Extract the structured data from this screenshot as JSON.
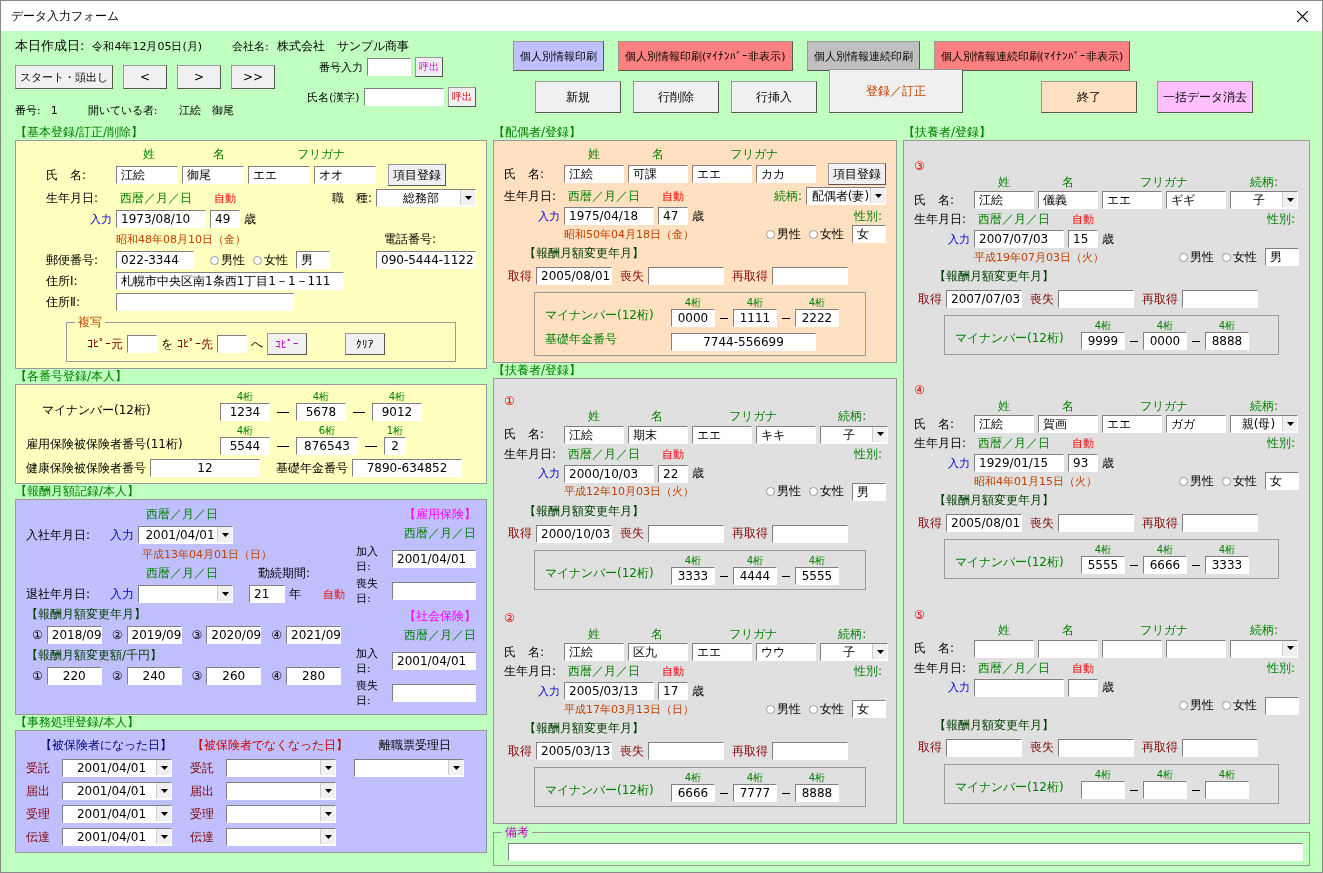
{
  "window": {
    "title": "データ入力フォーム"
  },
  "header": {
    "date_label": "本日作成日:",
    "date": "令和4年12月05日(月)",
    "company_label": "会社名:",
    "company": "株式会社　サンプル商事",
    "number_label": "番号:",
    "number": "1",
    "open_label": "開いている者:",
    "open_name": "江絵　御尾"
  },
  "nav_buttons": [
    "スタート・頭出し",
    "<",
    ">",
    ">>"
  ],
  "lookups": [
    {
      "label": "番号入力",
      "button": "呼出"
    },
    {
      "label": "氏名(漢字)",
      "button": "呼出"
    }
  ],
  "print_buttons": [
    {
      "label": "個人別情報印刷",
      "color": "#c0c0ff"
    },
    {
      "label": "個人別情報印刷(ﾏｲﾅﾝﾊﾞｰ非表示)",
      "color": "#ff8080"
    },
    {
      "label": "個人別情報連続印刷",
      "color": "#c0c0c0"
    },
    {
      "label": "個人別情報連続印刷(ﾏｲﾅﾝﾊﾞｰ非表示)",
      "color": "#ff8080"
    }
  ],
  "action_buttons": [
    {
      "label": "新規",
      "kind": "normal",
      "color": "#f0f0f0"
    },
    {
      "label": "行削除",
      "kind": "normal",
      "color": "#f0f0f0"
    },
    {
      "label": "行挿入",
      "kind": "normal",
      "color": "#f0f0f0"
    },
    {
      "label": "登録／訂正",
      "kind": "large",
      "color": "#f0f0f0"
    },
    {
      "label": "終了",
      "kind": "normal",
      "color": "#ffe0c0"
    },
    {
      "label": "一括データ消去",
      "kind": "normal",
      "color": "#ffc0ff"
    }
  ],
  "basic": {
    "title": "【基本登録/訂正/削除】",
    "name_label": "氏　名:",
    "headers": [
      "姓",
      "名",
      "フリガナ"
    ],
    "names": [
      "江絵",
      "御尾",
      "エエ",
      "オオ"
    ],
    "register_button": "項目登録",
    "birth_label": "生年月日:",
    "date_format": "西暦／月／日",
    "auto_label": "自動",
    "job_label": "職　種:",
    "job": "総務部",
    "input_label": "入力",
    "birth": "1973/08/10",
    "age": "49",
    "age_unit": "歳",
    "wareki": "昭和48年08月10日（金）",
    "phone_label": "電話番号:",
    "zip_label": "郵便番号:",
    "zip": "022-3344",
    "genders": [
      {
        "label": "男性",
        "selected": false
      },
      {
        "label": "女性",
        "selected": false
      }
    ],
    "gender": "男",
    "phone": "090-5444-1122",
    "addresses": [
      {
        "label": "住所Ⅰ:",
        "value": "札幌市中央区南1条西1丁目1－1－111"
      },
      {
        "label": "住所Ⅱ:"
      }
    ],
    "copy": {
      "title": "複写",
      "from_label": "ｺﾋﾟｰ元",
      "between": "を",
      "to_label": "ｺﾋﾟｰ先",
      "after": "へ",
      "copy_button": "ｺﾋﾟｰ",
      "clear_button": "ｸﾘｱ"
    }
  },
  "numbers": {
    "title": "【各番号登録/本人】",
    "mynumber": {
      "label": "マイナンバー(12桁)",
      "digits": [
        "4桁",
        "4桁",
        "4桁"
      ],
      "parts": [
        "1234",
        "5678",
        "9012"
      ]
    },
    "employment": {
      "label": "雇用保険被保険者番号(11桁)",
      "digits": [
        "4桁",
        "6桁",
        "1桁"
      ],
      "parts": [
        "5544",
        "876543",
        "2"
      ]
    },
    "health_label": "健康保険被保険者番号",
    "health": "12",
    "pension_label": "基礎年金番号",
    "pension": "7890-634852"
  },
  "salary": {
    "title": "【報酬月額記録/本人】",
    "join_format": "西暦／月／日",
    "join_label": "入社年月日:",
    "join_input": "入力",
    "join": "2001/04/01",
    "join_wareki": "平成13年04月01日（日）",
    "leave_format": "西暦／月／日",
    "tenure_label": "勤続期間:",
    "leave_label": "退社年月日:",
    "leave_input": "入力",
    "tenure": "21",
    "tenure_unit": "年",
    "auto_label": "自動",
    "month_title": "【報酬月額変更年月】",
    "months": [
      {
        "no": "①",
        "value": "2018/09"
      },
      {
        "no": "②",
        "value": "2019/09"
      },
      {
        "no": "③",
        "value": "2020/09"
      },
      {
        "no": "④",
        "value": "2021/09"
      }
    ],
    "amount_title": "【報酬月額変更額/千円】",
    "amounts": [
      {
        "no": "①",
        "value": "220"
      },
      {
        "no": "②",
        "value": "240"
      },
      {
        "no": "③",
        "value": "260"
      },
      {
        "no": "④",
        "value": "280"
      }
    ],
    "insurance": [
      {
        "title": "【雇用保険】",
        "date_format": "西暦／月／日",
        "join_label": "加入日:",
        "join": "2001/04/01",
        "loss_label": "喪失日:"
      },
      {
        "title": "【社会保険】",
        "date_format": "西暦／月／日",
        "join_label": "加入日:",
        "join": "2001/04/01",
        "loss_label": "喪失日:"
      }
    ]
  },
  "office": {
    "title": "【事務処理登録/本人】",
    "columns": [
      {
        "title": "【被保険者になった日】",
        "color": "#000080",
        "rows": [
          {
            "label": "受託",
            "value": "2001/04/01"
          },
          {
            "label": "届出",
            "value": "2001/04/01"
          },
          {
            "label": "受理",
            "value": "2001/04/01"
          },
          {
            "label": "伝達",
            "value": "2001/04/01"
          }
        ]
      },
      {
        "title": "【被保険者でなくなった日】",
        "color": "#d00000",
        "rows": [
          {
            "label": "受託"
          },
          {
            "label": "届出"
          },
          {
            "label": "受理"
          },
          {
            "label": "伝達"
          }
        ]
      }
    ],
    "separation_title": "離職票受理日"
  },
  "spouse": {
    "title": "【配偶者/登録】",
    "name_label": "氏　名:",
    "headers": [
      "姓",
      "名",
      "フリガナ"
    ],
    "names": [
      "江絵",
      "可課",
      "エエ",
      "カカ"
    ],
    "register_button": "項目登録",
    "birth_label": "生年月日:",
    "date_format": "西暦／月／日",
    "auto_label": "自動",
    "relation_label": "続柄:",
    "relation": "配偶者(妻)",
    "input_label": "入力",
    "birth": "1975/04/18",
    "age": "47",
    "age_unit": "歳",
    "gender_label": "性別:",
    "wareki": "昭和50年04月18日（金）",
    "genders": [
      {
        "label": "男性",
        "selected": false
      },
      {
        "label": "女性",
        "selected": false
      }
    ],
    "gender": "女",
    "history_title": "【報酬月額変更年月】",
    "history": [
      {
        "label": "取得",
        "value": "2005/08/01"
      },
      {
        "label": "喪失"
      },
      {
        "label": "再取得"
      }
    ],
    "mynumber": {
      "label": "マイナンバー(12桁)",
      "digits": [
        "4桁",
        "4桁",
        "4桁"
      ],
      "parts": [
        "0000",
        "1111",
        "2222"
      ],
      "pension_label": "基礎年金番号",
      "pension": "7744-556699"
    }
  },
  "dependent_panels": [
    {
      "title": "【扶養者/登録】",
      "members": [
        {
          "no": "①",
          "name_label": "氏　名:",
          "headers": [
            "姓",
            "名",
            "フリガナ"
          ],
          "relation_label": "続柄:",
          "names": [
            "江絵",
            "期末",
            "エエ",
            "キキ"
          ],
          "relation": "子",
          "birth_label": "生年月日:",
          "date_format": "西暦／月／日",
          "auto_label": "自動",
          "gender_label": "性別:",
          "input_label": "入力",
          "birth": "2000/10/03",
          "age": "22",
          "age_unit": "歳",
          "genders": [
            {
              "label": "男性",
              "selected": false
            },
            {
              "label": "女性",
              "selected": false
            }
          ],
          "gender": "男",
          "wareki": "平成12年10月03日（火）",
          "history_title": "【報酬月額変更年月】",
          "history": [
            {
              "label": "取得",
              "value": "2000/10/03"
            },
            {
              "label": "喪失"
            },
            {
              "label": "再取得"
            }
          ],
          "mynumber": {
            "label": "マイナンバー(12桁)",
            "digits": [
              "4桁",
              "4桁",
              "4桁"
            ],
            "parts": [
              "3333",
              "4444",
              "5555"
            ]
          }
        },
        {
          "no": "②",
          "name_label": "氏　名:",
          "headers": [
            "姓",
            "名",
            "フリガナ"
          ],
          "relation_label": "続柄:",
          "names": [
            "江絵",
            "区九",
            "エエ",
            "ウウ"
          ],
          "relation": "子",
          "birth_label": "生年月日:",
          "date_format": "西暦／月／日",
          "auto_label": "自動",
          "gender_label": "性別:",
          "input_label": "入力",
          "birth": "2005/03/13",
          "age": "17",
          "age_unit": "歳",
          "genders": [
            {
              "label": "男性",
              "selected": false
            },
            {
              "label": "女性",
              "selected": false
            }
          ],
          "gender": "女",
          "wareki": "平成17年03月13日（日）",
          "history_title": "【報酬月額変更年月】",
          "history": [
            {
              "label": "取得",
              "value": "2005/03/13"
            },
            {
              "label": "喪失"
            },
            {
              "label": "再取得"
            }
          ],
          "mynumber": {
            "label": "マイナンバー(12桁)",
            "digits": [
              "4桁",
              "4桁",
              "4桁"
            ],
            "parts": [
              "6666",
              "7777",
              "8888"
            ]
          }
        }
      ]
    },
    {
      "title": "【扶養者/登録】",
      "members": [
        {
          "no": "③",
          "name_label": "氏　名:",
          "headers": [
            "姓",
            "名",
            "フリガナ"
          ],
          "relation_label": "続柄:",
          "names": [
            "江絵",
            "儀義",
            "エエ",
            "ギギ"
          ],
          "relation": "子",
          "birth_label": "生年月日:",
          "date_format": "西暦／月／日",
          "auto_label": "自動",
          "gender_label": "性別:",
          "input_label": "入力",
          "birth": "2007/07/03",
          "age": "15",
          "age_unit": "歳",
          "genders": [
            {
              "label": "男性",
              "selected": false
            },
            {
              "label": "女性",
              "selected": false
            }
          ],
          "gender": "男",
          "wareki": "平成19年07月03日（火）",
          "history_title": "【報酬月額変更年月】",
          "history": [
            {
              "label": "取得",
              "value": "2007/07/03"
            },
            {
              "label": "喪失"
            },
            {
              "label": "再取得"
            }
          ],
          "mynumber": {
            "label": "マイナンバー(12桁)",
            "digits": [
              "4桁",
              "4桁",
              "4桁"
            ],
            "parts": [
              "9999",
              "0000",
              "8888"
            ]
          }
        },
        {
          "no": "④",
          "name_label": "氏　名:",
          "headers": [
            "姓",
            "名",
            "フリガナ"
          ],
          "relation_label": "続柄:",
          "names": [
            "江絵",
            "賀画",
            "エエ",
            "ガガ"
          ],
          "relation": "親(母)",
          "birth_label": "生年月日:",
          "date_format": "西暦／月／日",
          "auto_label": "自動",
          "gender_label": "性別:",
          "input_label": "入力",
          "birth": "1929/01/15",
          "age": "93",
          "age_unit": "歳",
          "genders": [
            {
              "label": "男性",
              "selected": false
            },
            {
              "label": "女性",
              "selected": false
            }
          ],
          "gender": "女",
          "wareki": "昭和4年01月15日（火）",
          "history_title": "【報酬月額変更年月】",
          "history": [
            {
              "label": "取得",
              "value": "2005/08/01"
            },
            {
              "label": "喪失"
            },
            {
              "label": "再取得"
            }
          ],
          "mynumber": {
            "label": "マイナンバー(12桁)",
            "digits": [
              "4桁",
              "4桁",
              "4桁"
            ],
            "parts": [
              "5555",
              "6666",
              "3333"
            ]
          }
        },
        {
          "no": "⑤",
          "name_label": "氏　名:",
          "headers": [
            "姓",
            "名",
            "フリガナ"
          ],
          "relation_label": "続柄:",
          "birth_label": "生年月日:",
          "date_format": "西暦／月／日",
          "auto_label": "自動",
          "gender_label": "性別:",
          "input_label": "入力",
          "age_unit": "歳",
          "genders": [
            {
              "label": "男性",
              "selected": false
            },
            {
              "label": "女性",
              "selected": false
            }
          ],
          "history_title": "【報酬月額変更年月】",
          "history": [
            {
              "label": "取得"
            },
            {
              "label": "喪失"
            },
            {
              "label": "再取得"
            }
          ],
          "mynumber": {
            "label": "マイナンバー(12桁)",
            "digits": [
              "4桁",
              "4桁",
              "4桁"
            ]
          }
        }
      ]
    }
  ],
  "notes": {
    "label": "備考"
  }
}
